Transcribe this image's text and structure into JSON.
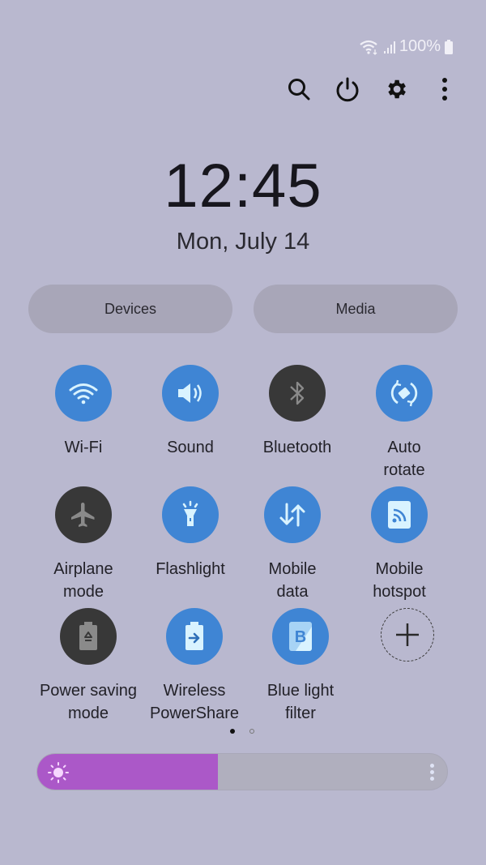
{
  "status_bar": {
    "icons": [
      "wifi-icon",
      "signal-icon",
      "battery-icon"
    ],
    "battery_text": "100%"
  },
  "toolbar": {
    "icons": [
      "search-icon",
      "power-icon",
      "gear-icon",
      "more-vertical-icon"
    ]
  },
  "clock": {
    "time": "12:45",
    "date": "Mon, July 14"
  },
  "panels": {
    "devices_label": "Devices",
    "media_label": "Media"
  },
  "tiles": [
    {
      "label": "Wi-Fi",
      "icon": "wifi-icon",
      "state": "on"
    },
    {
      "label": "Sound",
      "icon": "speaker-icon",
      "state": "on"
    },
    {
      "label": "Bluetooth",
      "icon": "bluetooth-icon",
      "state": "off"
    },
    {
      "label": "Auto\nrotate",
      "icon": "auto-rotate-icon",
      "state": "on"
    },
    {
      "label": "Airplane\nmode",
      "icon": "airplane-icon",
      "state": "off"
    },
    {
      "label": "Flashlight",
      "icon": "flashlight-icon",
      "state": "on"
    },
    {
      "label": "Mobile\ndata",
      "icon": "mobile-data-icon",
      "state": "on"
    },
    {
      "label": "Mobile\nhotspot",
      "icon": "hotspot-icon",
      "state": "on"
    },
    {
      "label": "Power saving\nmode",
      "icon": "power-saving-icon",
      "state": "off"
    },
    {
      "label": "Wireless\nPowerShare",
      "icon": "wireless-powershare-icon",
      "state": "on"
    },
    {
      "label": "Blue light\nfilter",
      "icon": "blue-light-filter-icon",
      "state": "on"
    },
    {
      "label": "",
      "icon": "add-icon",
      "state": "add"
    }
  ],
  "page_indicator": {
    "current": 1,
    "total": 2
  },
  "brightness": {
    "level_percent": 44,
    "colors": {
      "fill": "#ab58c8",
      "track": "#b0afbe"
    }
  },
  "colors": {
    "background": "#b9b8cf",
    "tile_on": "#3f85d4",
    "tile_off": "#383838"
  }
}
